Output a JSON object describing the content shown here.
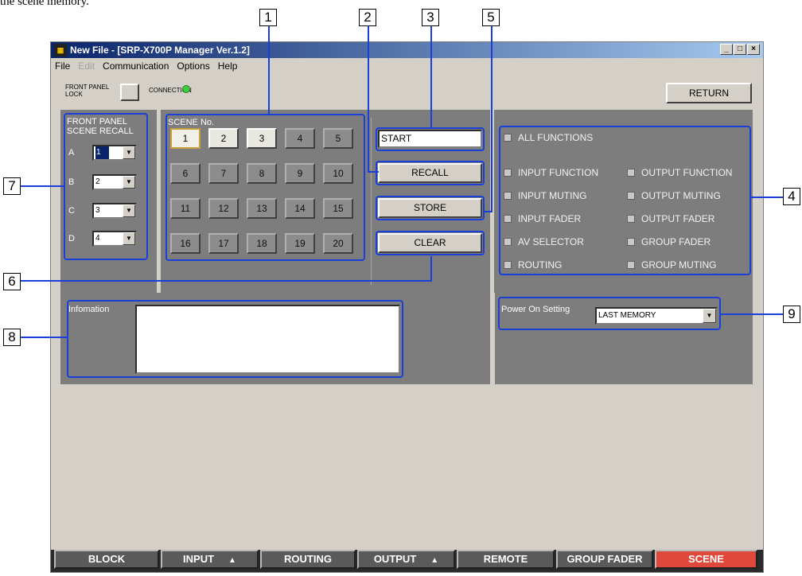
{
  "intro_text": "the scene memory.",
  "callouts": [
    "1",
    "2",
    "3",
    "4",
    "5",
    "6",
    "7",
    "8",
    "9"
  ],
  "window": {
    "title": "New File - [SRP-X700P Manager Ver.1.2]",
    "icon_name": "app-logo-icon",
    "controls": {
      "minimize": "_",
      "maximize": "□",
      "close": "×"
    }
  },
  "menu": [
    {
      "label": "File",
      "enabled": true
    },
    {
      "label": "Edit",
      "enabled": false
    },
    {
      "label": "Communication",
      "enabled": true
    },
    {
      "label": "Options",
      "enabled": true
    },
    {
      "label": "Help",
      "enabled": true
    }
  ],
  "toolbar": {
    "front_panel_lock_line1": "FRONT PANEL",
    "front_panel_lock_line2": "LOCK",
    "connection_label": "CONNECTION",
    "return_label": "RETURN"
  },
  "front_panel": {
    "title_line1": "FRONT PANEL",
    "title_line2": "SCENE RECALL",
    "rows": [
      {
        "letter": "A",
        "value": "1",
        "highlighted": true
      },
      {
        "letter": "B",
        "value": "2",
        "highlighted": false
      },
      {
        "letter": "C",
        "value": "3",
        "highlighted": false
      },
      {
        "letter": "D",
        "value": "4",
        "highlighted": false
      }
    ]
  },
  "scene": {
    "title": "SCENE No.",
    "buttons": [
      {
        "label": "1",
        "style": "sel"
      },
      {
        "label": "2",
        "style": "light"
      },
      {
        "label": "3",
        "style": "light"
      },
      {
        "label": "4",
        "style": "dark"
      },
      {
        "label": "5",
        "style": "dark"
      },
      {
        "label": "6",
        "style": "dark"
      },
      {
        "label": "7",
        "style": "dark"
      },
      {
        "label": "8",
        "style": "dark"
      },
      {
        "label": "9",
        "style": "dark"
      },
      {
        "label": "10",
        "style": "dark"
      },
      {
        "label": "11",
        "style": "dark"
      },
      {
        "label": "12",
        "style": "dark"
      },
      {
        "label": "13",
        "style": "dark"
      },
      {
        "label": "14",
        "style": "dark"
      },
      {
        "label": "15",
        "style": "dark"
      },
      {
        "label": "16",
        "style": "dark"
      },
      {
        "label": "17",
        "style": "dark"
      },
      {
        "label": "18",
        "style": "dark"
      },
      {
        "label": "19",
        "style": "dark"
      },
      {
        "label": "20",
        "style": "dark"
      }
    ],
    "name_value": "START",
    "recall_label": "RECALL",
    "store_label": "STORE",
    "clear_label": "CLEAR"
  },
  "functions": {
    "all": "ALL FUNCTIONS",
    "items": [
      "INPUT FUNCTION",
      "OUTPUT FUNCTION",
      "INPUT MUTING",
      "OUTPUT MUTING",
      "INPUT FADER",
      "OUTPUT FADER",
      "AV SELECTOR",
      "GROUP FADER",
      "ROUTING",
      "GROUP MUTING"
    ]
  },
  "information": {
    "label": "Infomation",
    "text": ""
  },
  "power_on": {
    "label": "Power On Setting",
    "value": "LAST MEMORY"
  },
  "tabs": [
    {
      "label": "BLOCK",
      "arrow": "",
      "active": false
    },
    {
      "label": "INPUT",
      "arrow": "▲",
      "active": false
    },
    {
      "label": "ROUTING",
      "arrow": "",
      "active": false
    },
    {
      "label": "OUTPUT",
      "arrow": "▲",
      "active": false
    },
    {
      "label": "REMOTE",
      "arrow": "",
      "active": false
    },
    {
      "label": "GROUP FADER",
      "arrow": "",
      "active": false
    },
    {
      "label": "SCENE",
      "arrow": "",
      "active": true
    }
  ],
  "colors": {
    "highlight_frame": "#1b3fd9",
    "panel": "#7d7d7d",
    "active_tab": "#e0483c"
  }
}
